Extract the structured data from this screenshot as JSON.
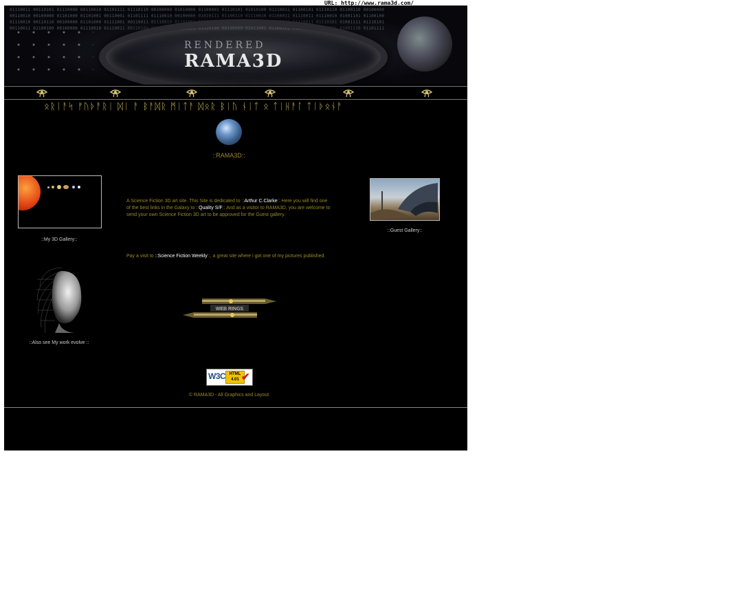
{
  "url_bar": {
    "text": "URL: http://www.rama3d.com/"
  },
  "banner": {
    "binary_rows": [
      "01110011 00110101 01110000 00110010 01101111 01110110 00100000 01010000 01100001 01110101 01010100 01110011 01100101 01110110 01100110 00100000",
      "00110010 00100000 01101000 01101001 00110001 01101111 01110010 00100000 01010111 01100110 01110010 01100011 01110011 01110010 01001101 01100100",
      "01110010 00110110 00100000 01101000 01111001 00110011 01110010 01101001 01101111 00100000 01011000 01100010 01110011 01110101 01001111 01110101",
      "00110011 01100100 00100000 01110010 01110011 00110100 01110001 01110101 01110100 00100000 01011001 01100101 01100110 01110111 01001110 01101111"
    ],
    "logo_top": "RENDERED",
    "logo_bottom": "RAMA3D"
  },
  "nav": {
    "items": [
      {
        "icon": "eye-of-horus-icon"
      },
      {
        "icon": "eye-of-horus-icon"
      },
      {
        "icon": "eye-of-horus-icon"
      },
      {
        "icon": "eye-of-horus-icon"
      },
      {
        "icon": "eye-of-horus-icon"
      },
      {
        "icon": "eye-of-horus-icon"
      }
    ]
  },
  "heading": {
    "alien_text": "ᛟᚱᛁᚨᛋ ᚠᚢᚦᚨᚱᛁ ᛞᛁ ᚨ ᛒᚨᛞᚱ ᛗᛁᛏᚨ ᛞᛟᚱ ᛒᛁᚢ ᚾᛁᛏ ᛟ ᛏᛁᚺᚨᛚ ᛏᛁᚦᛟᚾᚨ"
  },
  "site_title": "::RAMA3D::",
  "left_column": {
    "gallery_label": "::My 3D Gallery::",
    "also_label": "::Also see My work evolve ::"
  },
  "center": {
    "intro_pre": "A Science Fiction 3D art site. This Site is dedicated to ::",
    "intro_link1": "Arthur C.Clarke",
    "intro_mid": ":: Here you will find one of the best links in the Galaxy to ::",
    "intro_link2": "Quality S/F",
    "intro_post": ":: And as a visitor to RAMA3D, you are welcome to send your own Science Fiction 3D art to be approved for the Guest gallery.",
    "visit_pre": "Pay a visit to ",
    "visit_link": "::Science Fiction Weekly",
    "visit_post": "::, a great site where i got one of my pictures published.",
    "webring_label": "WEB RINGS"
  },
  "right_column": {
    "guest_label": "::Guest Gallery::"
  },
  "footer": {
    "w3c_text": "W3C",
    "w3c_html": "HTML 4.01",
    "copyright": "© RAMA3D - All Graphics and Layout"
  },
  "colors": {
    "page_bg": "#ffffff",
    "site_bg": "#000000",
    "gold_text": "#9a8a2a",
    "label_text": "#cccccc"
  }
}
